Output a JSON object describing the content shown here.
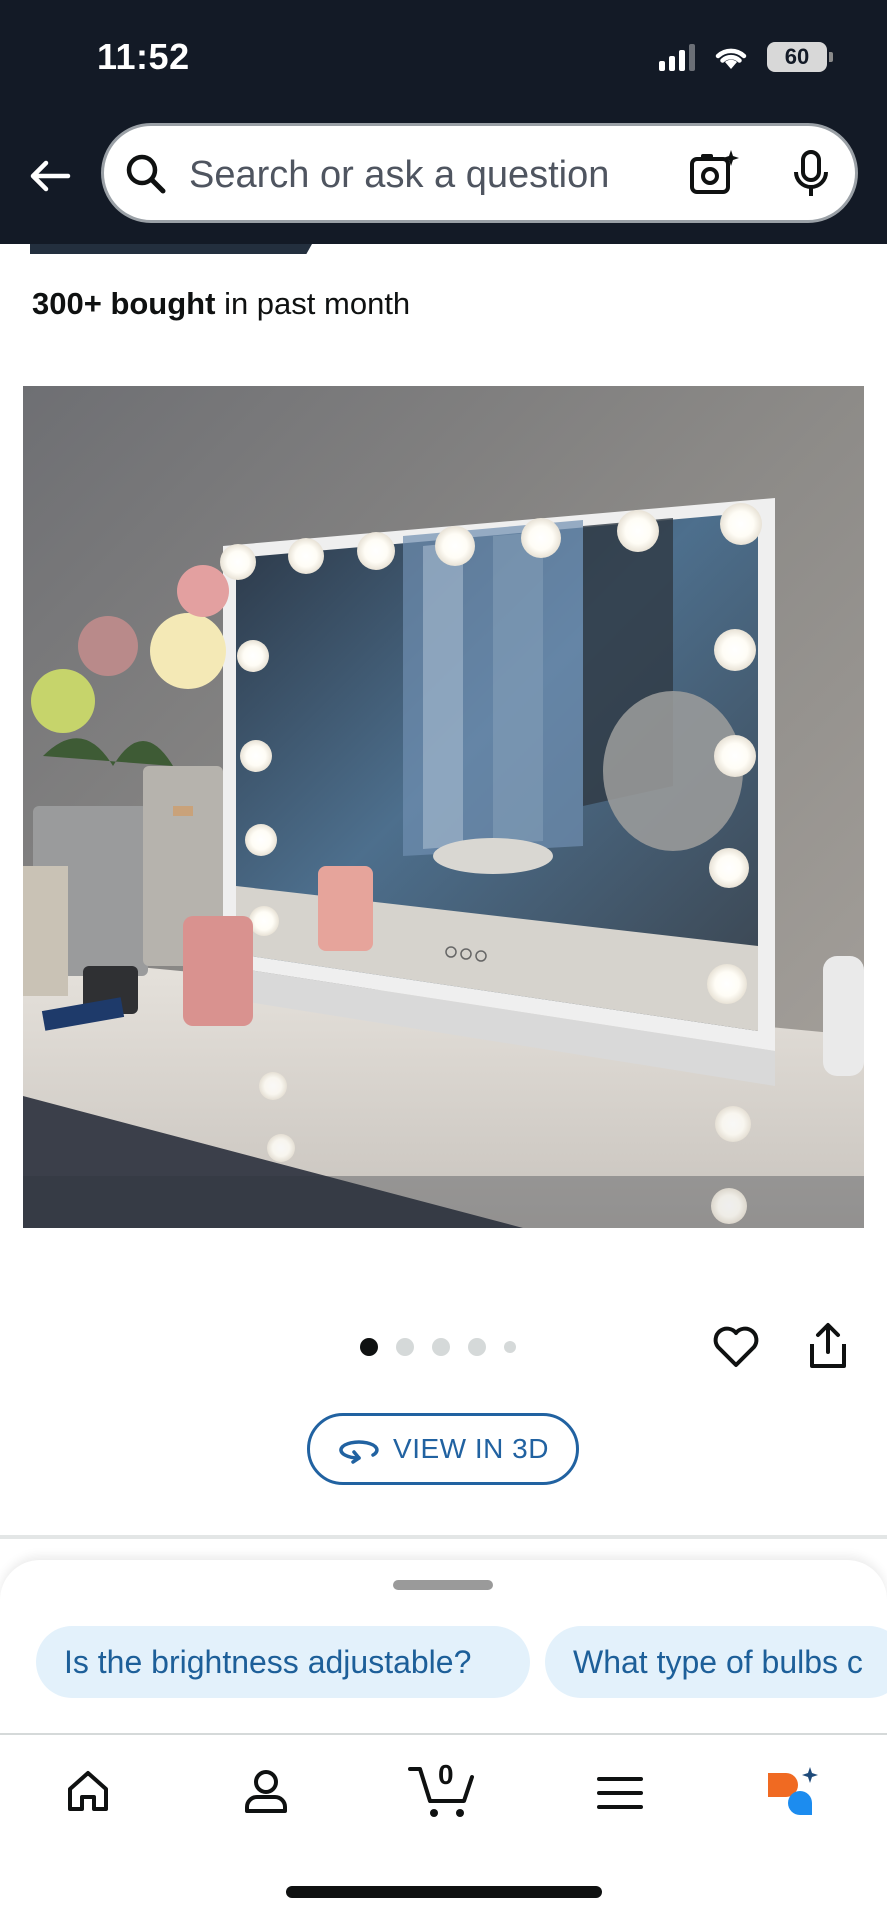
{
  "status_bar": {
    "time": "11:52",
    "battery": "60"
  },
  "search": {
    "placeholder": "Search or ask a question"
  },
  "product": {
    "bought_count": "300+ bought",
    "bought_suffix": " in past month",
    "image_count": 5,
    "current_image": 1
  },
  "buttons": {
    "view_3d": "VIEW IN 3D"
  },
  "suggestions": [
    {
      "label": "Is the brightness adjustable?"
    },
    {
      "label": "What type of bulbs c"
    }
  ],
  "nav": {
    "cart_count": "0"
  },
  "icons": {
    "back": "back-arrow-icon",
    "search": "search-icon",
    "camera": "camera-search-icon",
    "mic": "microphone-icon",
    "heart": "heart-icon",
    "share": "share-icon",
    "rotate": "rotate-3d-icon",
    "home": "home-icon",
    "account": "account-icon",
    "cart": "cart-icon",
    "menu": "menu-icon",
    "rufus": "rufus-assistant-icon"
  },
  "colors": {
    "header": "#131a26",
    "link": "#2162a1",
    "chip_bg": "#e3f1fb",
    "chip_text": "#1d5f99"
  }
}
